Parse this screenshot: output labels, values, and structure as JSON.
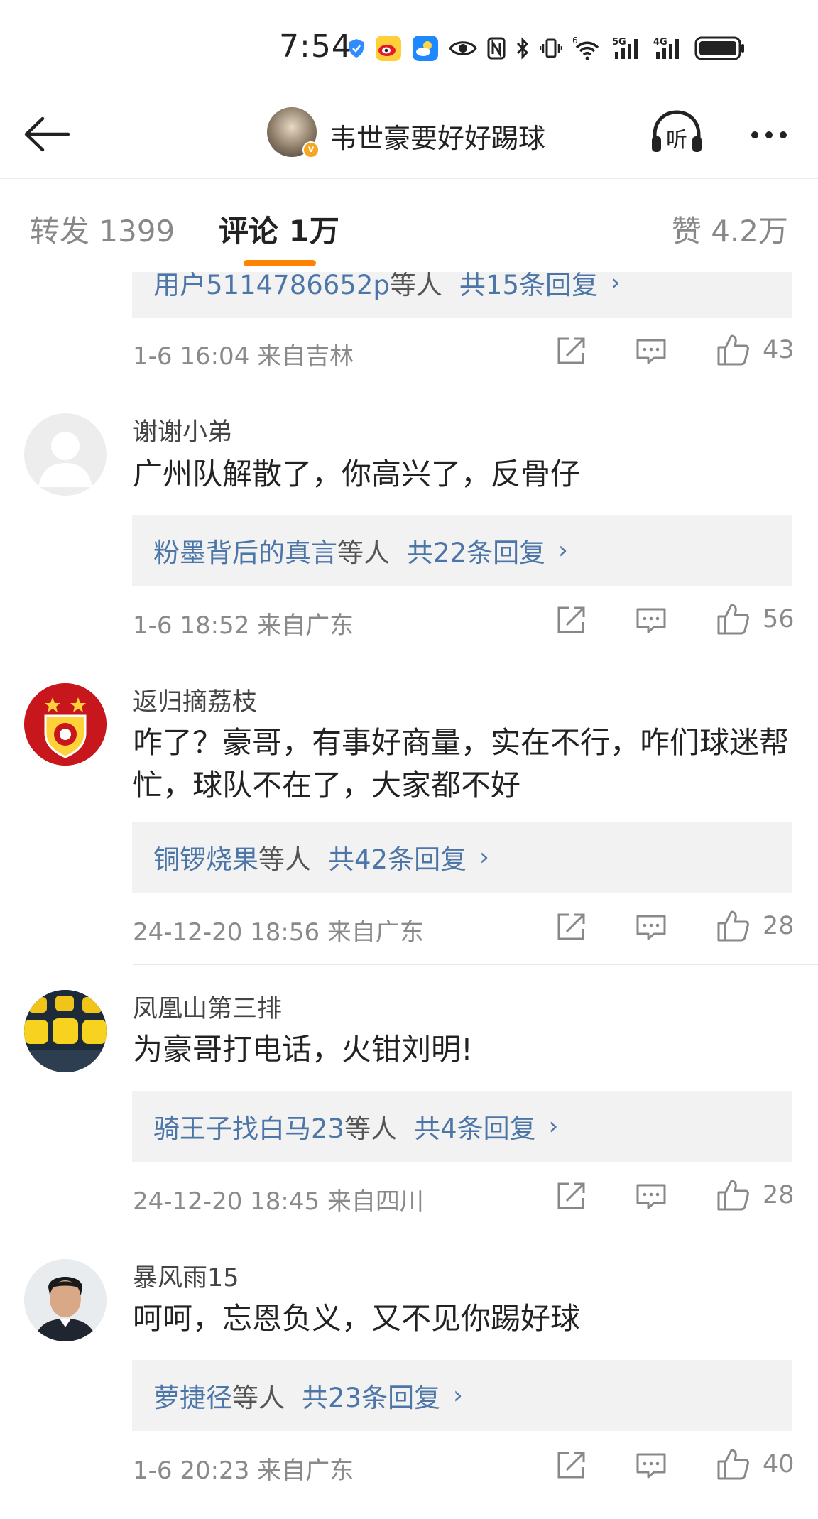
{
  "status_bar": {
    "time": "7:54",
    "icons": [
      "shield-check-icon",
      "weibo-app-icon",
      "weather-app-icon",
      "eye-icon",
      "nfc-icon",
      "bluetooth-icon",
      "vibrate-icon",
      "wifi-icon",
      "signal-5g-icon",
      "signal-4g-icon",
      "battery-icon"
    ],
    "network_labels": [
      "6",
      "5G",
      "4G"
    ]
  },
  "nav": {
    "title": "韦世豪要好好踢球",
    "listen_label": "听",
    "avatar_badge": "v"
  },
  "tabs": [
    {
      "label": "转发 1399",
      "active": false
    },
    {
      "label": "评论 1万",
      "active": true
    },
    {
      "label": "赞 4.2万",
      "active": false
    }
  ],
  "accent_color": "#ff8200",
  "link_color": "#4d76a8",
  "partial_comment": {
    "reply_names": "用户5114786652p",
    "reply_etc": "等人",
    "reply_total": "共15条回复",
    "reply_chevron": "›",
    "meta": "1-6 16:04 来自吉林",
    "likes": "43"
  },
  "comments": [
    {
      "user": "谢谢小弟",
      "text": "广州队解散了，你高兴了，反骨仔",
      "reply_names": "粉墨背后的真言",
      "reply_etc": "等人",
      "reply_total": "共22条回复",
      "reply_chevron": "›",
      "meta": "1-6 18:52 来自广东",
      "likes": "56",
      "avatar": "default-avatar"
    },
    {
      "user": "返归摘荔枝",
      "text": "咋了？豪哥，有事好商量，实在不行，咋们球迷帮忙，球队不在了，大家都不好",
      "reply_names": "铜锣烧果",
      "reply_etc": "等人",
      "reply_total": "共42条回复",
      "reply_chevron": "›",
      "meta": "24-12-20 18:56 来自广东",
      "likes": "28",
      "avatar": "club-crest-avatar"
    },
    {
      "user": "凤凰山第三排",
      "text": "为豪哥打电话，火钳刘明!",
      "reply_names": "骑王子找白马23",
      "reply_etc": "等人",
      "reply_total": "共4条回复",
      "reply_chevron": "›",
      "meta": "24-12-20 18:45 来自四川",
      "likes": "28",
      "avatar": "stadium-seats-avatar"
    },
    {
      "user": "暴风雨15",
      "text": "呵呵，忘恩负义，又不见你踢好球",
      "reply_names": "萝捷径",
      "reply_etc": "等人",
      "reply_total": "共23条回复",
      "reply_chevron": "›",
      "meta": "1-6 20:23 来自广东",
      "likes": "40",
      "avatar": "person-photo-avatar"
    }
  ]
}
